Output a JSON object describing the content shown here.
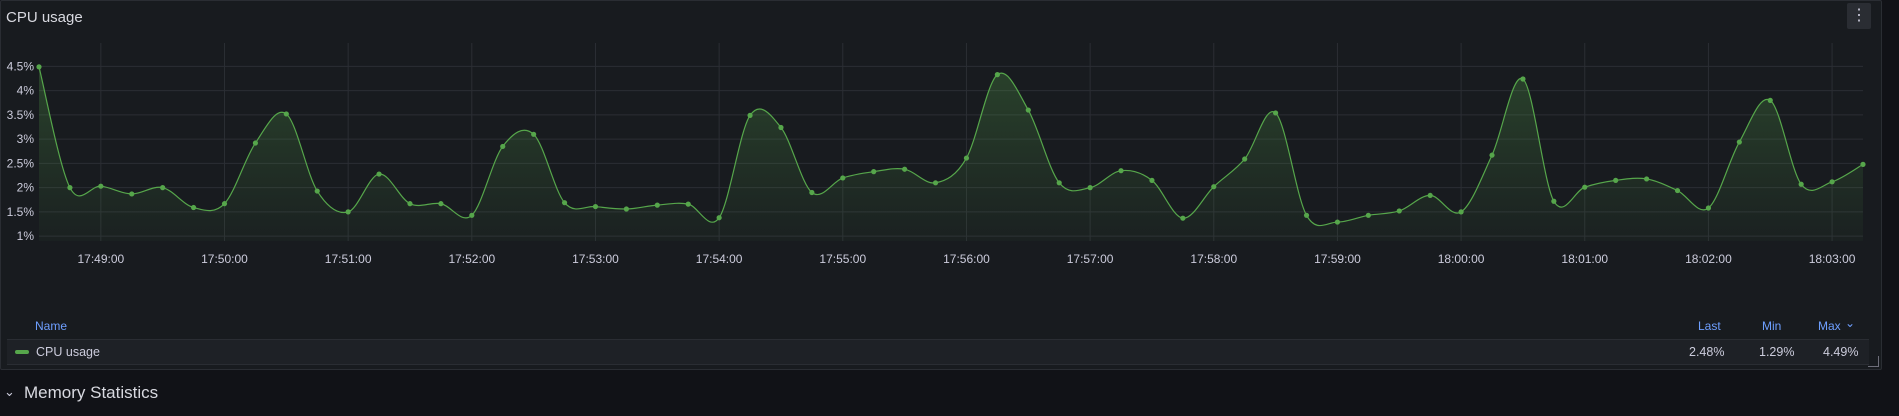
{
  "panel": {
    "title": "CPU usage",
    "menu_icon": "kebab-menu-icon",
    "menu_label": "⋮"
  },
  "chart_data": {
    "type": "line",
    "title": "CPU usage",
    "xlabel": "",
    "ylabel": "",
    "ylim": [
      0.9,
      4.9
    ],
    "grid": true,
    "y_ticks": [
      "1%",
      "1.5%",
      "2%",
      "2.5%",
      "3%",
      "3.5%",
      "4%",
      "4.5%"
    ],
    "x_ticks": [
      "17:49:00",
      "17:50:00",
      "17:51:00",
      "17:52:00",
      "17:53:00",
      "17:54:00",
      "17:55:00",
      "17:56:00",
      "17:57:00",
      "17:58:00",
      "17:59:00",
      "18:00:00",
      "18:01:00",
      "18:02:00",
      "18:03:00"
    ],
    "series": [
      {
        "name": "CPU usage",
        "color": "#56a64b",
        "times": [
          "17:48:30",
          "17:48:45",
          "17:49:00",
          "17:49:15",
          "17:49:30",
          "17:49:45",
          "17:50:00",
          "17:50:15",
          "17:50:30",
          "17:50:45",
          "17:51:00",
          "17:51:15",
          "17:51:30",
          "17:51:45",
          "17:52:00",
          "17:52:15",
          "17:52:30",
          "17:52:45",
          "17:53:00",
          "17:53:15",
          "17:53:30",
          "17:53:45",
          "17:54:00",
          "17:54:15",
          "17:54:30",
          "17:54:45",
          "17:55:00",
          "17:55:15",
          "17:55:30",
          "17:55:45",
          "17:56:00",
          "17:56:15",
          "17:56:30",
          "17:56:45",
          "17:57:00",
          "17:57:15",
          "17:57:30",
          "17:57:45",
          "17:58:00",
          "17:58:15",
          "17:58:30",
          "17:58:45",
          "17:59:00",
          "17:59:15",
          "17:59:30",
          "17:59:45",
          "18:00:00",
          "18:00:15",
          "18:00:30",
          "18:00:45",
          "18:01:00",
          "18:01:15",
          "18:01:30",
          "18:01:45",
          "18:02:00",
          "18:02:15",
          "18:02:30",
          "18:02:45",
          "18:03:00",
          "18:03:15"
        ],
        "values": [
          4.49,
          2.0,
          2.03,
          1.87,
          2.0,
          1.59,
          1.67,
          2.92,
          3.52,
          1.93,
          1.5,
          2.28,
          1.67,
          1.67,
          1.43,
          2.85,
          3.1,
          1.69,
          1.61,
          1.56,
          1.64,
          1.66,
          1.38,
          3.49,
          3.24,
          1.9,
          2.2,
          2.33,
          2.38,
          2.1,
          2.61,
          4.33,
          3.6,
          2.1,
          2.0,
          2.35,
          2.15,
          1.37,
          2.02,
          2.59,
          3.54,
          1.43,
          1.29,
          1.43,
          1.52,
          1.84,
          1.5,
          2.67,
          4.24,
          1.72,
          2.01,
          2.15,
          2.18,
          1.94,
          1.58,
          2.94,
          3.8,
          2.07,
          2.12,
          2.48
        ]
      }
    ]
  },
  "legend": {
    "header_name": "Name",
    "header_last": "Last",
    "header_min": "Min",
    "header_max": "Max",
    "sort_icon": "chevron-down-icon",
    "sort_glyph": "⌄",
    "row": {
      "name": "CPU usage",
      "last": "2.48%",
      "min": "1.29%",
      "max": "4.49%"
    }
  },
  "section": {
    "title": "Memory Statistics",
    "chevron_icon": "chevron-down-icon",
    "chevron_glyph": "⌄"
  }
}
